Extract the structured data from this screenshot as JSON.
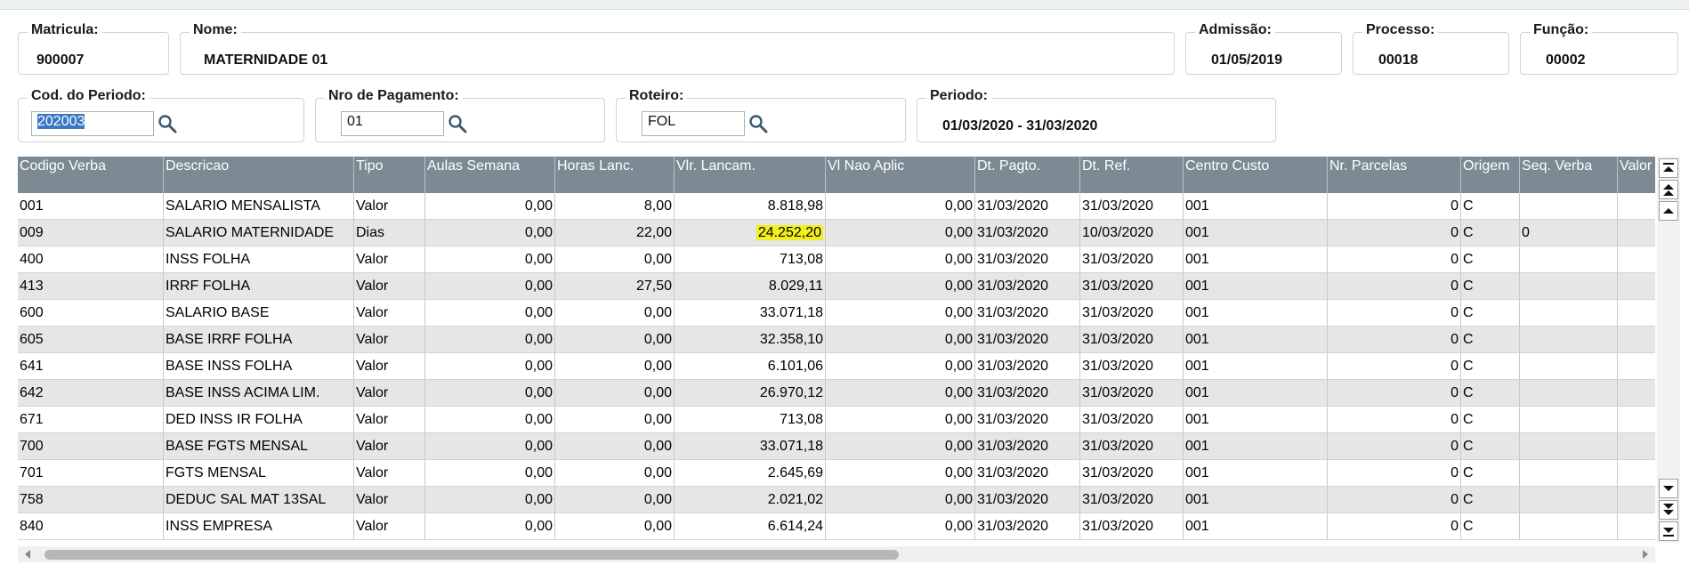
{
  "header": {
    "matricula": {
      "label": "Matricula:",
      "value": "900007"
    },
    "nome": {
      "label": "Nome:",
      "value": "MATERNIDADE 01"
    },
    "admissao": {
      "label": "Admissão:",
      "value": "01/05/2019"
    },
    "processo": {
      "label": "Processo:",
      "value": "00018"
    },
    "funcao": {
      "label": "Função:",
      "value": "00002"
    }
  },
  "filters": {
    "cod_periodo": {
      "label": "Cod. do Periodo:",
      "value": "202003",
      "icon": "search-icon"
    },
    "nro_pagamento": {
      "label": "Nro de Pagamento:",
      "value": "01",
      "icon": "search-icon"
    },
    "roteiro": {
      "label": "Roteiro:",
      "value": "FOL",
      "icon": "search-icon"
    },
    "periodo": {
      "label": "Periodo:",
      "value": "01/03/2020 - 31/03/2020"
    }
  },
  "grid": {
    "highlight_color": "#f2ef1e",
    "header_color": "#7c8b93",
    "columns": [
      "Codigo Verba",
      "Descricao",
      "Tipo",
      "Aulas Semana",
      "Horas Lanc.",
      "Vlr. Lancam.",
      "Vl Nao Aplic",
      "Dt. Pagto.",
      "Dt. Ref.",
      "Centro Custo",
      "Nr. Parcelas",
      "Origem",
      "Seq. Verba",
      "Valor I"
    ],
    "rows": [
      [
        "001",
        "SALARIO  MENSALISTA",
        "Valor",
        "0,00",
        "8,00",
        "8.818,98",
        "0,00",
        "31/03/2020",
        "31/03/2020",
        "001",
        "0",
        "C",
        ""
      ],
      [
        "009",
        "SALARIO MATERNIDADE",
        "Dias",
        "0,00",
        "22,00",
        "24.252,20",
        "0,00",
        "31/03/2020",
        "10/03/2020",
        "001",
        "0",
        "C",
        "0"
      ],
      [
        "400",
        "INSS FOLHA",
        "Valor",
        "0,00",
        "0,00",
        "713,08",
        "0,00",
        "31/03/2020",
        "31/03/2020",
        "001",
        "0",
        "C",
        ""
      ],
      [
        "413",
        "IRRF FOLHA",
        "Valor",
        "0,00",
        "27,50",
        "8.029,11",
        "0,00",
        "31/03/2020",
        "31/03/2020",
        "001",
        "0",
        "C",
        ""
      ],
      [
        "600",
        "SALARIO BASE",
        "Valor",
        "0,00",
        "0,00",
        "33.071,18",
        "0,00",
        "31/03/2020",
        "31/03/2020",
        "001",
        "0",
        "C",
        ""
      ],
      [
        "605",
        "BASE IRRF FOLHA",
        "Valor",
        "0,00",
        "0,00",
        "32.358,10",
        "0,00",
        "31/03/2020",
        "31/03/2020",
        "001",
        "0",
        "C",
        ""
      ],
      [
        "641",
        "BASE INSS FOLHA",
        "Valor",
        "0,00",
        "0,00",
        "6.101,06",
        "0,00",
        "31/03/2020",
        "31/03/2020",
        "001",
        "0",
        "C",
        ""
      ],
      [
        "642",
        "BASE INSS ACIMA LIM.",
        "Valor",
        "0,00",
        "0,00",
        "26.970,12",
        "0,00",
        "31/03/2020",
        "31/03/2020",
        "001",
        "0",
        "C",
        ""
      ],
      [
        "671",
        "DED INSS IR FOLHA",
        "Valor",
        "0,00",
        "0,00",
        "713,08",
        "0,00",
        "31/03/2020",
        "31/03/2020",
        "001",
        "0",
        "C",
        ""
      ],
      [
        "700",
        "BASE FGTS MENSAL",
        "Valor",
        "0,00",
        "0,00",
        "33.071,18",
        "0,00",
        "31/03/2020",
        "31/03/2020",
        "001",
        "0",
        "C",
        ""
      ],
      [
        "701",
        "FGTS MENSAL",
        "Valor",
        "0,00",
        "0,00",
        "2.645,69",
        "0,00",
        "31/03/2020",
        "31/03/2020",
        "001",
        "0",
        "C",
        ""
      ],
      [
        "758",
        "DEDUC SAL MAT 13SAL",
        "Valor",
        "0,00",
        "0,00",
        "2.021,02",
        "0,00",
        "31/03/2020",
        "31/03/2020",
        "001",
        "0",
        "C",
        ""
      ],
      [
        "840",
        "INSS EMPRESA",
        "Valor",
        "0,00",
        "0,00",
        "6.614,24",
        "0,00",
        "31/03/2020",
        "31/03/2020",
        "001",
        "0",
        "C",
        ""
      ]
    ]
  }
}
